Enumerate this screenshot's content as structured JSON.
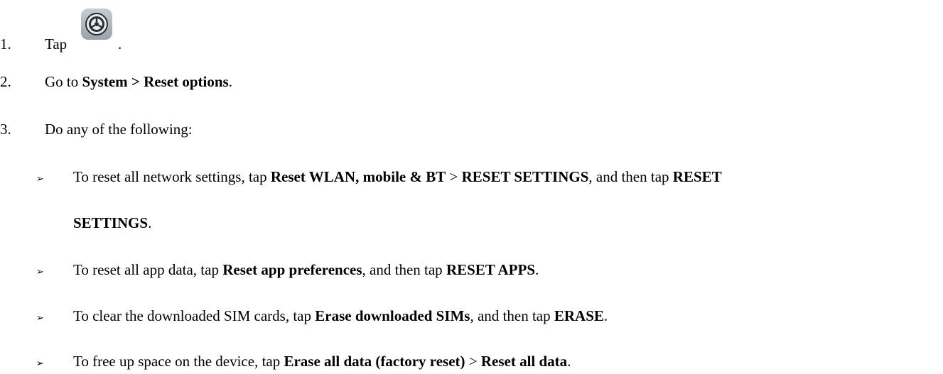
{
  "steps": [
    {
      "number": "1.",
      "text_before": "Tap",
      "icon": "settings-gear-icon",
      "text_after": "."
    },
    {
      "number": "2.",
      "parts": [
        "Go to ",
        "System > Reset options",
        "."
      ]
    },
    {
      "number": "3.",
      "text": "Do any of the following:"
    }
  ],
  "bullet_symbol": "➢",
  "bullets": [
    {
      "parts": [
        "To reset all network settings, tap ",
        "Reset WLAN, mobile & BT",
        " > ",
        "RESET SETTINGS",
        ", and then tap ",
        "RESET"
      ],
      "continuation": [
        "SETTINGS",
        "."
      ]
    },
    {
      "parts": [
        "To reset all app data, tap ",
        "Reset app preferences",
        ", and then tap ",
        "RESET APPS",
        "."
      ]
    },
    {
      "parts": [
        "To clear the downloaded SIM cards, tap ",
        "Erase downloaded SIMs",
        ", and then tap ",
        "ERASE",
        "."
      ]
    },
    {
      "parts": [
        "To free up space on the device, tap ",
        "Erase all data (factory reset)",
        " > ",
        "Reset all data",
        "."
      ]
    }
  ]
}
